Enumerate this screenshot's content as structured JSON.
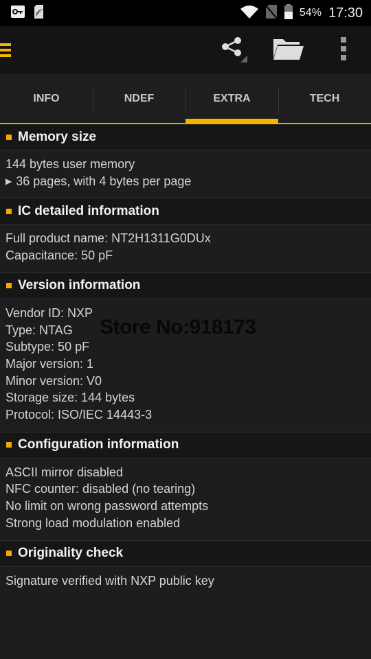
{
  "status_bar": {
    "battery_percent": "54%",
    "time": "17:30",
    "icons_left": [
      "key-icon",
      "nfc-tag-icon"
    ],
    "icons_right": [
      "wifi-icon",
      "no-sim-icon",
      "battery-icon"
    ]
  },
  "app_bar": {
    "menu_icon": "hamburger-icon",
    "actions": [
      "share-icon",
      "folder-icon",
      "more-vert-icon"
    ]
  },
  "tabs": [
    {
      "label": "INFO",
      "active": false
    },
    {
      "label": "NDEF",
      "active": false
    },
    {
      "label": "EXTRA",
      "active": true
    },
    {
      "label": "TECH",
      "active": false
    }
  ],
  "sections": [
    {
      "title": "Memory size",
      "lines": [
        "144 bytes user memory",
        "36 pages, with 4 bytes per page"
      ]
    },
    {
      "title": "IC detailed information",
      "lines": [
        "Full product name: NT2H1311G0DUx",
        "Capacitance: 50 pF"
      ]
    },
    {
      "title": "Version information",
      "lines": [
        "Vendor ID: NXP",
        "Type: NTAG",
        "Subtype: 50 pF",
        "Major version: 1",
        "Minor version: V0",
        "Storage size: 144 bytes",
        "Protocol: ISO/IEC 14443-3"
      ]
    },
    {
      "title": "Configuration information",
      "lines": [
        "ASCII mirror disabled",
        "NFC counter: disabled (no tearing)",
        "No limit on wrong password attempts",
        "Strong load modulation enabled"
      ]
    },
    {
      "title": "Originality check",
      "lines": [
        "Signature verified with NXP public key"
      ]
    }
  ],
  "watermark": "Store No:918173",
  "colors": {
    "accent": "#f5b400",
    "background": "#1d1d1d",
    "header_bg": "#161616"
  }
}
